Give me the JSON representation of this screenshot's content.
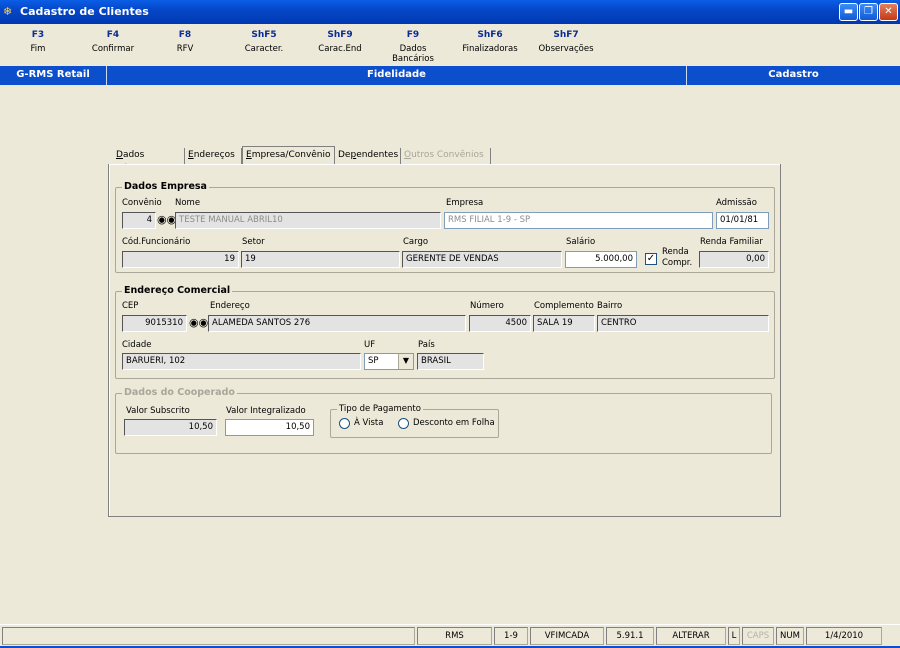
{
  "window": {
    "title": "Cadastro de Clientes"
  },
  "fkeys": [
    {
      "key": "F3",
      "label": "Fim"
    },
    {
      "key": "F4",
      "label": "Confirmar"
    },
    {
      "key": "F8",
      "label": "RFV"
    },
    {
      "key": "ShF5",
      "label": "Caracter."
    },
    {
      "key": "ShF9",
      "label": "Carac.End"
    },
    {
      "key": "F9",
      "label": "Dados Bancários"
    },
    {
      "key": "ShF6",
      "label": "Finalizadoras"
    },
    {
      "key": "ShF7",
      "label": "Observações"
    }
  ],
  "header": {
    "app": "G-RMS Retail",
    "module": "Fidelidade",
    "mode": "Cadastro"
  },
  "tabs": [
    {
      "label": "Dados Básicos",
      "u": "D",
      "rest": "ados Básicos"
    },
    {
      "label": "Endereços",
      "u": "E",
      "rest": "ndereços"
    },
    {
      "label": "Empresa/Convênio",
      "u": "E",
      "rest": "mpresa/Convênio"
    },
    {
      "label": "Dependentes",
      "pre": "De",
      "u": "p",
      "rest": "endentes"
    },
    {
      "label": "Outros Convênios",
      "u": "O",
      "rest": "utros Convênios"
    }
  ],
  "empresa": {
    "title": "Dados Empresa",
    "convenio_label": "Convênio",
    "convenio": "4",
    "nome_label": "Nome",
    "nome": "TESTE MANUAL ABRIL10",
    "empresa_label": "Empresa",
    "empresa": "RMS FILIAL 1-9 - SP",
    "admissao_label": "Admissão",
    "admissao": "01/01/81",
    "cod_label": "Cód.Funcionário",
    "cod": "19",
    "setor_label": "Setor",
    "setor": "19",
    "cargo_label": "Cargo",
    "cargo": "GERENTE DE VENDAS",
    "salario_label": "Salário",
    "salario": "5.000,00",
    "renda_label": "Renda",
    "compr_label": "Compr.",
    "renda_familiar_label": "Renda Familiar",
    "renda_familiar": "0,00"
  },
  "endereco": {
    "title": "Endereço Comercial",
    "cep_label": "CEP",
    "cep": "9015310",
    "end_label": "Endereço",
    "end": "ALAMEDA SANTOS 276",
    "numero_label": "Número",
    "numero": "4500",
    "compl_label": "Complemento",
    "compl": "SALA 19",
    "bairro_label": "Bairro",
    "bairro": "CENTRO",
    "cidade_label": "Cidade",
    "cidade": "BARUERI, 102",
    "uf_label": "UF",
    "uf": "SP",
    "pais_label": "País",
    "pais": "BRASIL"
  },
  "cooperado": {
    "title": "Dados do Cooperado",
    "subscrito_label": "Valor Subscrito",
    "subscrito": "10,50",
    "integralizado_label": "Valor Integralizado",
    "integralizado": "10,50",
    "pagamento_label": "Tipo de Pagamento",
    "opt1": "À Vista",
    "opt2": "Desconto em Folha"
  },
  "status": [
    "RMS",
    "1-9",
    "VFIMCADA",
    "5.91.1",
    "ALTERAR",
    "L",
    "CAPS",
    "NUM",
    "1/4/2010"
  ]
}
